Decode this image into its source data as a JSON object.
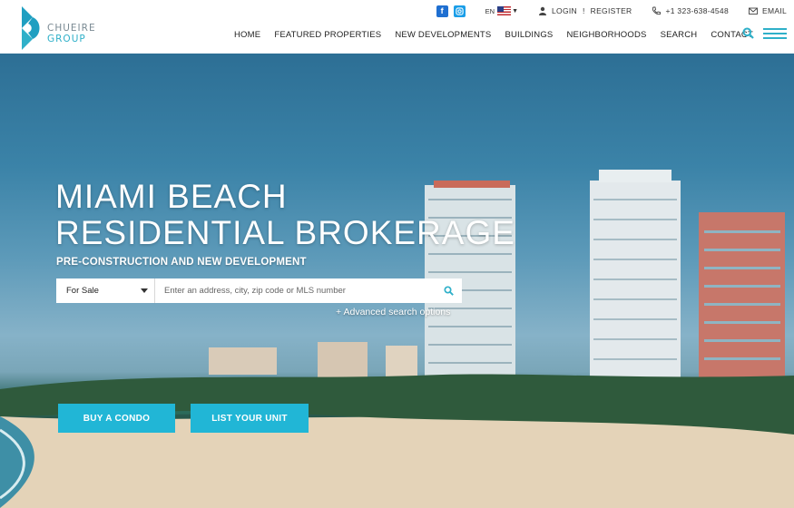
{
  "brand": {
    "line1": "CHUEIRE",
    "line2": "GROUP",
    "accent": "#2fb0c9"
  },
  "topbar": {
    "social": [
      "facebook-icon",
      "instagram-icon"
    ],
    "lang": "EN",
    "login": "LOGIN",
    "register": "REGISTER",
    "phone": "+1 323-638-4548",
    "email": "EMAIL"
  },
  "nav": {
    "items": [
      "HOME",
      "FEATURED PROPERTIES",
      "NEW DEVELOPMENTS",
      "BUILDINGS",
      "NEIGHBORHOODS",
      "SEARCH",
      "CONTACT"
    ]
  },
  "hero": {
    "title_line1": "MIAMI BEACH",
    "title_line2": "RESIDENTIAL BROKERAGE",
    "subtitle": "PRE-CONSTRUCTION AND NEW DEVELOPMENT",
    "search": {
      "type_selected": "For Sale",
      "placeholder": "Enter an address, city, zip code or MLS number",
      "advanced": "+ Advanced search options"
    },
    "buttons": {
      "buy": "BUY A CONDO",
      "list": "LIST YOUR UNIT"
    },
    "button_color": "#21b6d6"
  }
}
